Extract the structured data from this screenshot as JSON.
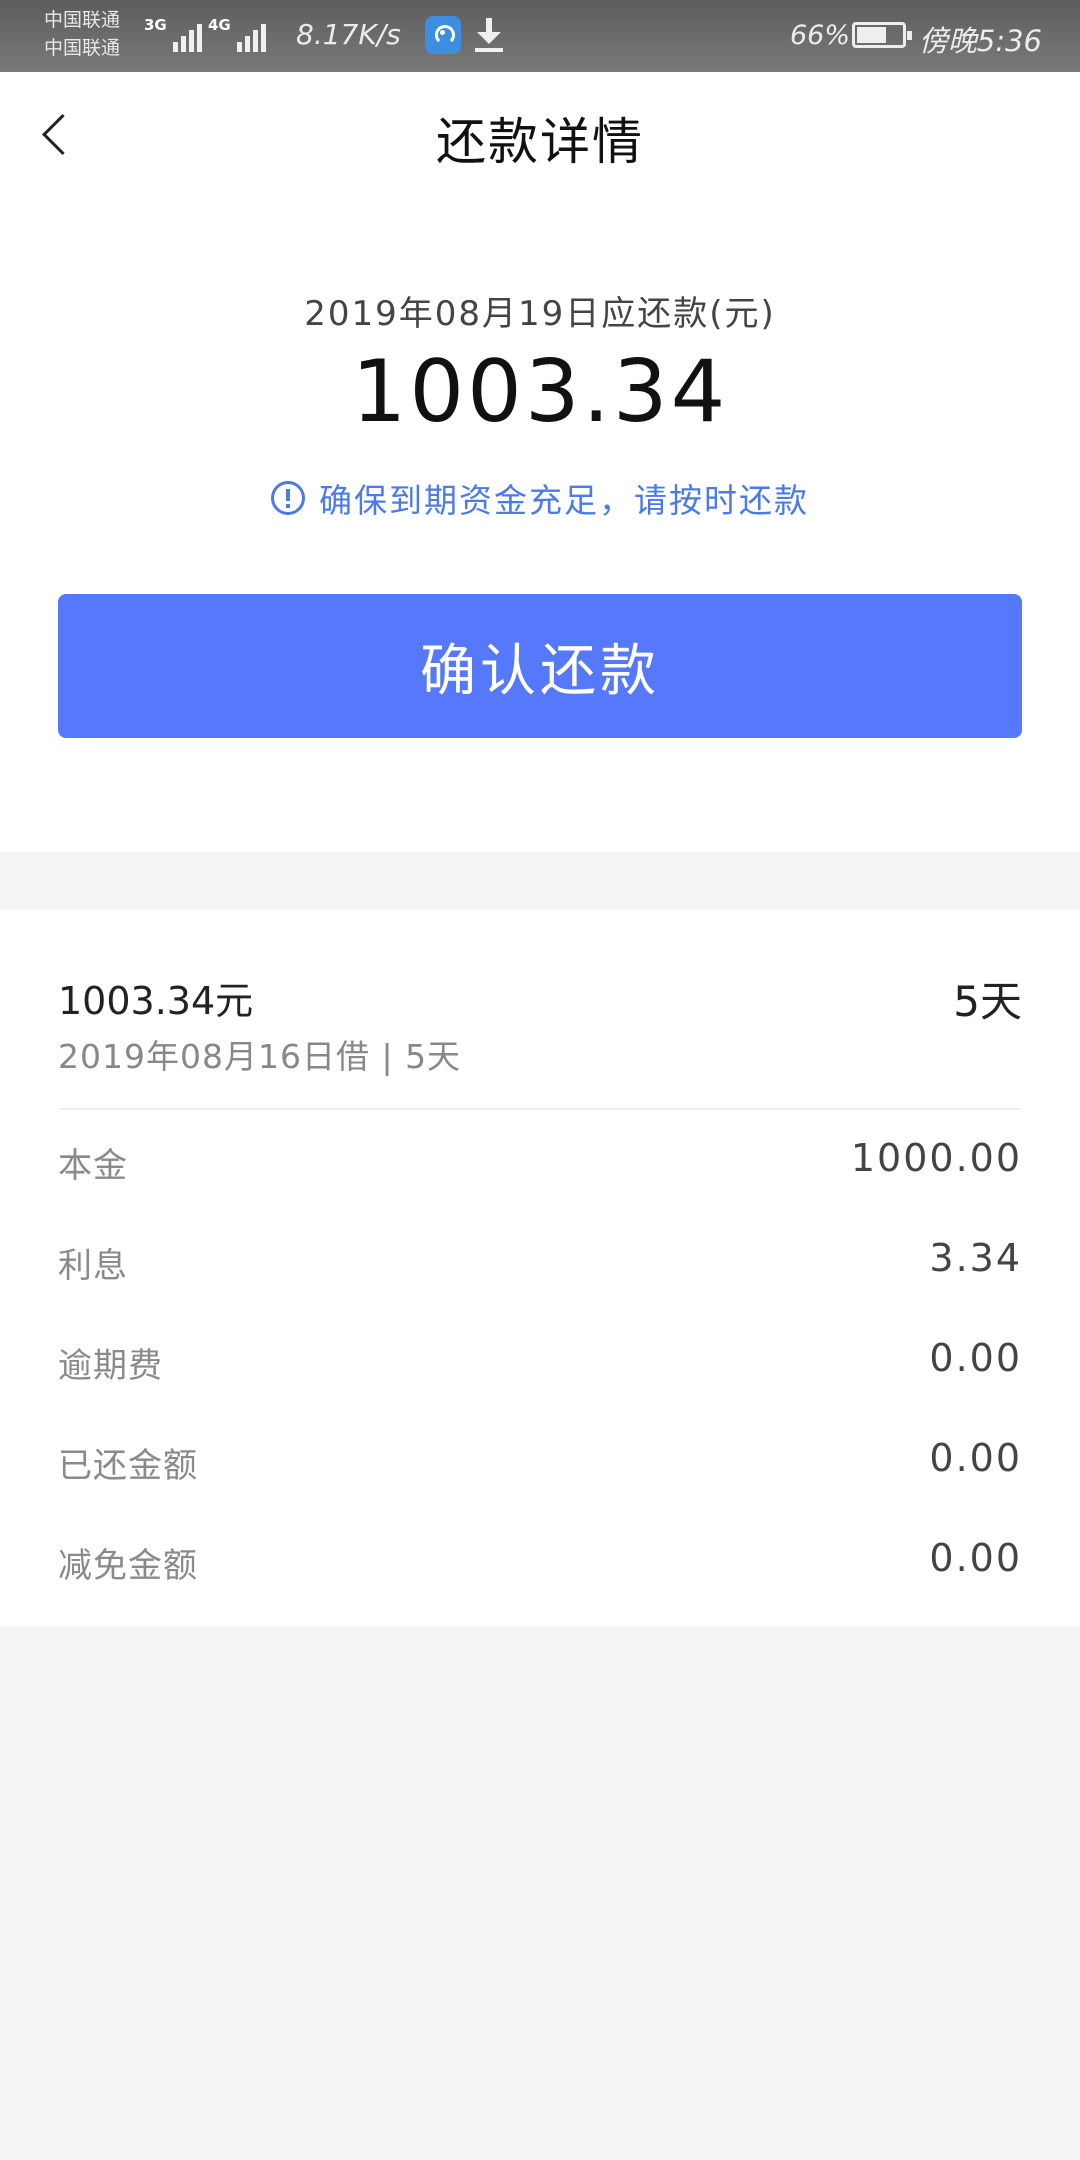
{
  "status_bar": {
    "carrier_1": "中国联通",
    "carrier_2": "中国联通",
    "network_1": "3G",
    "network_2": "4G",
    "speed": "8.17K/s",
    "battery": "66%",
    "battery_level": 0.66,
    "time": "傍晚5:36"
  },
  "header": {
    "title": "还款详情"
  },
  "summary": {
    "due_label": "2019年08月19日应还款(元)",
    "due_amount": "1003.34",
    "reminder": "确保到期资金充足，请按时还款",
    "confirm_label": "确认还款"
  },
  "loan": {
    "amount": "1003.34元",
    "meta": "2019年08月16日借 | 5天",
    "days": "5天"
  },
  "details": [
    {
      "label": "本金",
      "value": "1000.00"
    },
    {
      "label": "利息",
      "value": "3.34"
    },
    {
      "label": "逾期费",
      "value": "0.00"
    },
    {
      "label": "已还金额",
      "value": "0.00"
    },
    {
      "label": "减免金额",
      "value": "0.00"
    }
  ],
  "colors": {
    "accent": "#5679fb",
    "reminder": "#4c7be6",
    "background": "#f4f4f4"
  }
}
